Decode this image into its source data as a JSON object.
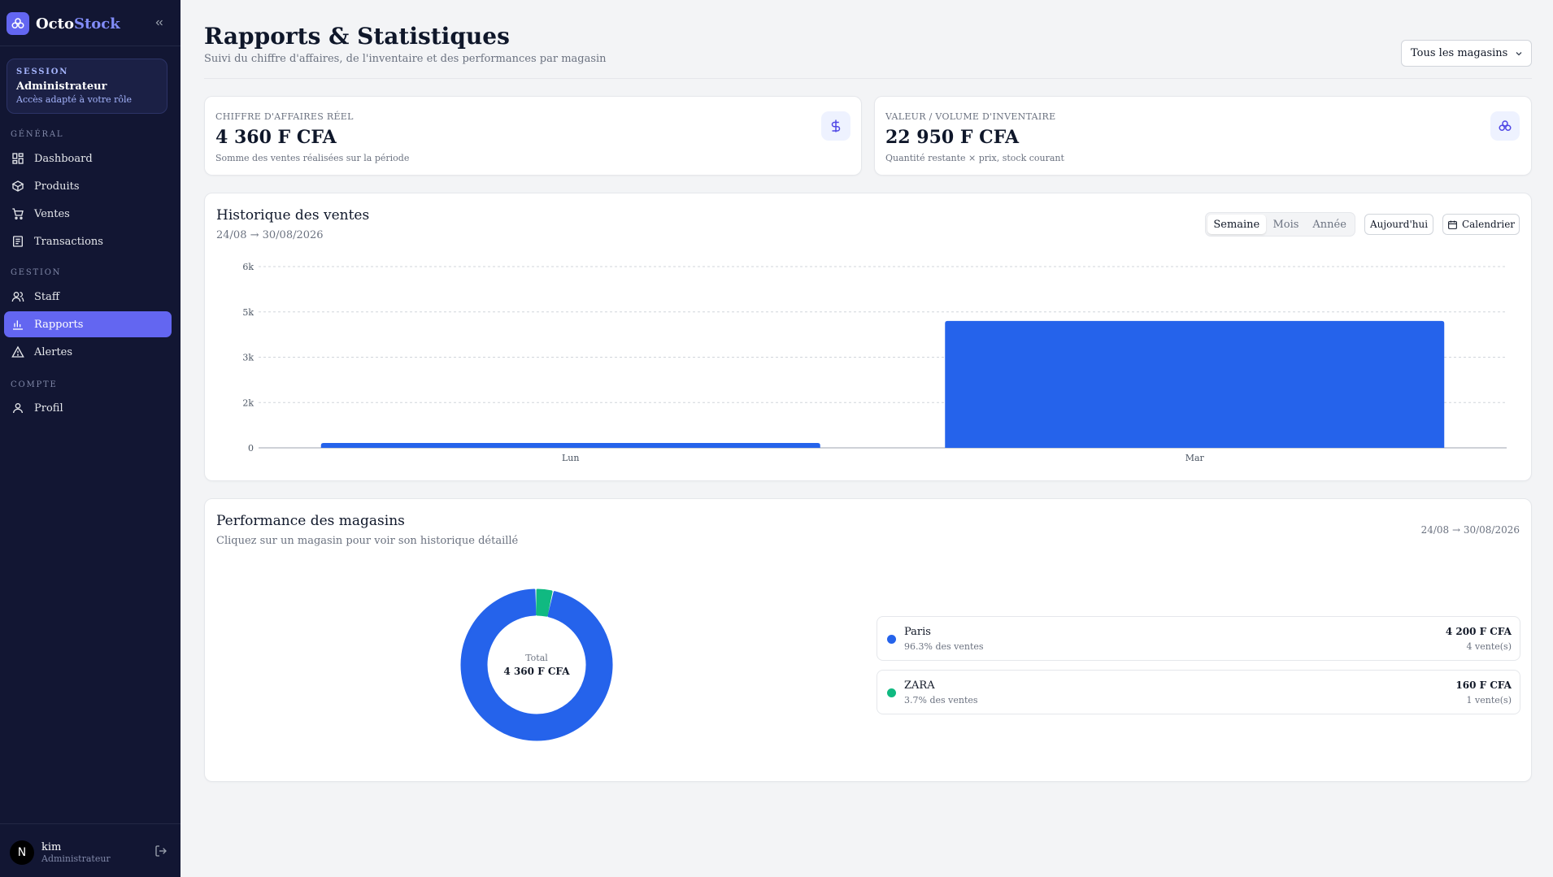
{
  "brand": {
    "name_a": "Octo",
    "name_b": "Stock"
  },
  "session": {
    "kicker": "SESSION",
    "role": "Administrateur",
    "subtitle": "Accès adapté à votre rôle"
  },
  "nav": {
    "section_general": "GÉNÉRAL",
    "section_gestion": "GESTION",
    "section_compte": "COMPTE",
    "dashboard": "Dashboard",
    "produits": "Produits",
    "ventes": "Ventes",
    "transactions": "Transactions",
    "staff": "Staff",
    "rapports": "Rapports",
    "alertes": "Alertes",
    "profil": "Profil"
  },
  "user": {
    "initial": "N",
    "name": "kim",
    "role": "Administrateur"
  },
  "header": {
    "title": "Rapports & Statistiques",
    "subtitle": "Suivi du chiffre d'affaires, de l'inventaire et des performances par magasin",
    "store_select": "Tous les magasins"
  },
  "kpi": {
    "revenue": {
      "kicker": "CHIFFRE D'AFFAIRES RÉEL",
      "value": "4 360 F CFA",
      "sub": "Somme des ventes réalisées sur la période"
    },
    "inventory": {
      "kicker": "VALEUR / VOLUME D'INVENTAIRE",
      "value": "22 950 F CFA",
      "sub": "Quantité restante × prix, stock courant"
    }
  },
  "history": {
    "title": "Historique des ventes",
    "range": "24/08 → 30/08/2026",
    "tabs": [
      "Semaine",
      "Mois",
      "Année"
    ],
    "active_tab": "Semaine",
    "today_btn": "Aujourd'hui",
    "calendar_btn": "Calendrier"
  },
  "performance": {
    "title": "Performance des magasins",
    "subtitle": "Cliquez sur un magasin pour voir son historique détaillé",
    "range": "24/08 → 30/08/2026",
    "total_label": "Total",
    "total_value": "4 360 F CFA",
    "stores": [
      {
        "name": "Paris",
        "pct": "96.3% des ventes",
        "amount": "4 200 F CFA",
        "count": "4 vente(s)",
        "color": "#2563eb"
      },
      {
        "name": "ZARA",
        "pct": "3.7% des ventes",
        "amount": "160 F CFA",
        "count": "1 vente(s)",
        "color": "#10b981"
      }
    ]
  },
  "chart_data": [
    {
      "type": "bar",
      "categories": [
        "Lun",
        "Mar"
      ],
      "values": [
        160,
        4200
      ],
      "yticks": [
        0,
        1500,
        3000,
        4500,
        6000
      ],
      "ytick_labels": [
        "0",
        "2k",
        "3k",
        "5k",
        "6k"
      ],
      "ylim": [
        0,
        6000
      ],
      "grid": true,
      "color": "#2563eb"
    },
    {
      "type": "pie",
      "categories": [
        "Paris",
        "ZARA"
      ],
      "values": [
        4200,
        160
      ],
      "colors": [
        "#2563eb",
        "#10b981"
      ]
    }
  ]
}
